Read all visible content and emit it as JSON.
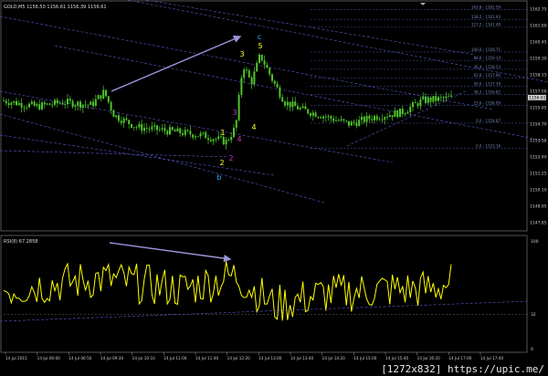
{
  "main_header": "GOLD,M5  1156.50 1156.61 1156.39 1156.61",
  "rsi_header": "RSI(8) 67.2858",
  "watermark": "[1272x832] https://upic.me/",
  "colors": {
    "background": "#000000",
    "bull_candle": "#4fc52a",
    "bear_candle": "#4fc52a",
    "rsi_line": "#ffff00",
    "channel_lines": "#5a5acf",
    "fib_lines": "#3a4a8a",
    "annotation_arrow": "#9b95dd",
    "wave_yellow": "#ffff33",
    "wave_magenta": "#cc33cc",
    "wave_cyan": "#33aaff",
    "price_label_bg": "#d0d0d0"
  },
  "price_axis": {
    "current_price": "1156.61",
    "ticks": [
      "1162.75",
      "1161.60",
      "1160.45",
      "1159.30",
      "1158.15",
      "1157.00",
      "1155.85",
      "1154.70",
      "1153.55",
      "1152.40",
      "1151.25",
      "1150.10",
      "1148.95",
      "1147.85"
    ]
  },
  "rsi_axis": {
    "ticks": [
      "100",
      "32",
      "0"
    ]
  },
  "time_axis": {
    "ticks": [
      "14 Jul 2015",
      "14 Jul 06:00",
      "14 Jul 06:50",
      "14 Jul 09:30",
      "14 Jul 10:10",
      "14 Jul 11:00",
      "14 Jul 11:40",
      "14 Jul 12:20",
      "14 Jul 13:00",
      "14 Jul 13:40",
      "14 Jul 14:20",
      "14 Jul 15:00",
      "14 Jul 15:40",
      "14 Jul 16:20",
      "14 Jul 17:00",
      "14 Jul 17:40"
    ]
  },
  "fib_levels": [
    {
      "label": "161.8 - 1162.59",
      "price": 1162.59
    },
    {
      "label": "138.2 - 1161.93",
      "price": 1161.93
    },
    {
      "label": "127.2 - 1161.40",
      "price": 1161.4
    },
    {
      "label": "100.0 - 1159.71",
      "price": 1159.71
    },
    {
      "label": "88.6 - 1159.14",
      "price": 1159.14
    },
    {
      "label": "76.4 - 1158.53",
      "price": 1158.53
    },
    {
      "label": "61.8 - 1157.96",
      "price": 1157.96
    },
    {
      "label": "50.0 - 1157.39",
      "price": 1157.39
    },
    {
      "label": "38.2 - 1156.82",
      "price": 1156.82
    },
    {
      "label": "23.6 - 1156.09",
      "price": 1156.09
    },
    {
      "label": "0.0 - 1154.87",
      "price": 1154.87
    },
    {
      "label": "0.0 - 1153.16",
      "price": 1153.16
    }
  ],
  "wave_labels": [
    {
      "text": "3",
      "color": "#ffff33"
    },
    {
      "text": "4",
      "color": "#ffff33"
    },
    {
      "text": "5",
      "color": "#ffff33"
    },
    {
      "text": "c",
      "color": "#33aaff"
    },
    {
      "text": "1",
      "color": "#ffff33"
    },
    {
      "text": "2",
      "color": "#ffff33"
    },
    {
      "text": "b",
      "color": "#33aaff"
    },
    {
      "text": "3",
      "color": "#cc33cc"
    },
    {
      "text": "4",
      "color": "#cc33cc"
    },
    {
      "text": "2",
      "color": "#cc33cc"
    }
  ],
  "chart_data": {
    "type": "candlestick",
    "price_ylim": [
      1147.85,
      1162.75
    ],
    "rsi_ylim": [
      0,
      100
    ],
    "seed": 7
  }
}
